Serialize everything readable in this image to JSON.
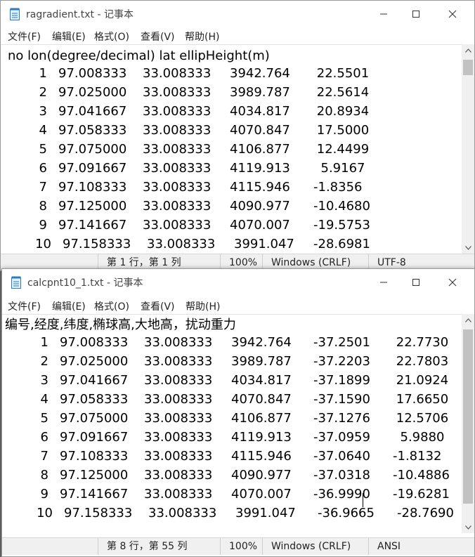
{
  "window1": {
    "title": "ragradient.txt - 记事本",
    "menu": [
      "文件(F)",
      "编辑(E)",
      "格式(O)",
      "查看(V)",
      "帮助(H)"
    ],
    "header": "no lon(degree/decimal) lat ellipHeight(m)",
    "rows": [
      [
        "1",
        "97.008333",
        "33.008333",
        "3942.764",
        "22.5501"
      ],
      [
        "2",
        "97.025000",
        "33.008333",
        "3989.787",
        "22.5614"
      ],
      [
        "3",
        "97.041667",
        "33.008333",
        "4034.817",
        "20.8934"
      ],
      [
        "4",
        "97.058333",
        "33.008333",
        "4070.847",
        "17.5000"
      ],
      [
        "5",
        "97.075000",
        "33.008333",
        "4106.877",
        "12.4499"
      ],
      [
        "6",
        "97.091667",
        "33.008333",
        "4119.913",
        "5.9167"
      ],
      [
        "7",
        "97.108333",
        "33.008333",
        "4115.946",
        "-1.8356"
      ],
      [
        "8",
        "97.125000",
        "33.008333",
        "4090.977",
        "-10.4680"
      ],
      [
        "9",
        "97.141667",
        "33.008333",
        "4070.007",
        "-19.5753"
      ],
      [
        "10",
        "97.158333",
        "33.008333",
        "3991.047",
        "-28.6981"
      ]
    ],
    "status": {
      "position": "第 1 行，第 1 列",
      "zoom": "100%",
      "line_ending": "Windows (CRLF)",
      "encoding": "UTF-8"
    }
  },
  "window2": {
    "title": "calcpnt10_1.txt - 记事本",
    "menu": [
      "文件(F)",
      "编辑(E)",
      "格式(O)",
      "查看(V)",
      "帮助(H)"
    ],
    "header": "编号,经度,纬度,椭球高,大地高，扰动重力",
    "rows": [
      [
        "1",
        "97.008333",
        "33.008333",
        "3942.764",
        "-37.2501",
        "22.7730"
      ],
      [
        "2",
        "97.025000",
        "33.008333",
        "3989.787",
        "-37.2203",
        "22.7803"
      ],
      [
        "3",
        "97.041667",
        "33.008333",
        "4034.817",
        "-37.1899",
        "21.0924"
      ],
      [
        "4",
        "97.058333",
        "33.008333",
        "4070.847",
        "-37.1590",
        "17.6650"
      ],
      [
        "5",
        "97.075000",
        "33.008333",
        "4106.877",
        "-37.1276",
        "12.5706"
      ],
      [
        "6",
        "97.091667",
        "33.008333",
        "4119.913",
        "-37.0959",
        "5.9880"
      ],
      [
        "7",
        "97.108333",
        "33.008333",
        "4115.946",
        "-37.0640",
        "-1.8132"
      ],
      [
        "8",
        "97.125000",
        "33.008333",
        "4090.977",
        "-37.0318",
        "-10.4886"
      ],
      [
        "9",
        "97.141667",
        "33.008333",
        "4070.007",
        "-36.9990",
        "-19.6281"
      ],
      [
        "10",
        "97.158333",
        "33.008333",
        "3991.047",
        "-36.9665",
        "-28.7690"
      ]
    ],
    "status": {
      "position": "第 8 行，第 55 列",
      "zoom": "100%",
      "line_ending": "Windows (CRLF)",
      "encoding": "ANSI"
    }
  }
}
